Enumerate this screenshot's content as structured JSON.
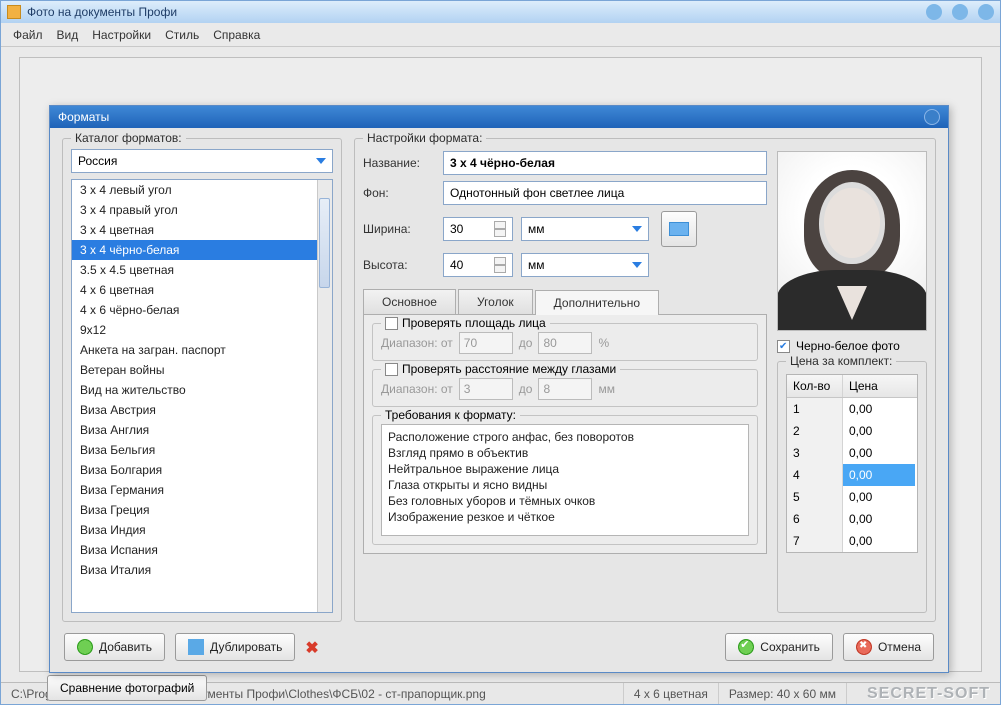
{
  "window": {
    "title": "Фото на документы Профи"
  },
  "menu": [
    "Файл",
    "Вид",
    "Настройки",
    "Стиль",
    "Справка"
  ],
  "bg_button": "Сравнение фотографий",
  "dialog": {
    "title": "Форматы",
    "catalog_legend": "Каталог форматов:",
    "country": "Россия",
    "items": [
      "3 x 4 левый угол",
      "3 x 4 правый угол",
      "3 x 4 цветная",
      "3 x 4 чёрно-белая",
      "3.5 x 4.5 цветная",
      "4 x 6 цветная",
      "4 x 6 чёрно-белая",
      "9x12",
      "Анкета на загран. паспорт",
      "Ветеран войны",
      "Вид на жительство",
      "Виза Австрия",
      "Виза Англия",
      "Виза Бельгия",
      "Виза Болгария",
      "Виза Германия",
      "Виза Греция",
      "Виза Индия",
      "Виза Испания",
      "Виза Италия"
    ],
    "selected_index": 3,
    "settings_legend": "Настройки формата:",
    "name_label": "Название:",
    "name_value": "3 x 4 чёрно-белая",
    "bg_label": "Фон:",
    "bg_value": "Однотонный фон светлее лица",
    "width_label": "Ширина:",
    "width_value": "30",
    "height_label": "Высота:",
    "height_value": "40",
    "unit": "мм",
    "tabs": [
      "Основное",
      "Уголок",
      "Дополнительно"
    ],
    "active_tab": 2,
    "check_face": "Проверять площадь лица",
    "check_eyes": "Проверять расстояние между глазами",
    "range_label": "Диапазон: от",
    "range_to": "до",
    "face_from": "70",
    "face_to": "80",
    "face_unit": "%",
    "eyes_from": "3",
    "eyes_to": "8",
    "eyes_unit": "мм",
    "reqs_legend": "Требования к формату:",
    "reqs": [
      "Расположение строго анфас, без поворотов",
      "Взгляд прямо в объектив",
      "Нейтральное выражение лица",
      "Глаза открыты и ясно видны",
      "Без головных уборов и тёмных очков",
      "Изображение резкое и чёткое"
    ],
    "bw_label": "Черно-белое фото",
    "price_legend": "Цена за комплект:",
    "price_headers": [
      "Кол-во",
      "Цена"
    ],
    "prices": [
      {
        "q": "1",
        "p": "0,00"
      },
      {
        "q": "2",
        "p": "0,00"
      },
      {
        "q": "3",
        "p": "0,00"
      },
      {
        "q": "4",
        "p": "0,00"
      },
      {
        "q": "5",
        "p": "0,00"
      },
      {
        "q": "6",
        "p": "0,00"
      },
      {
        "q": "7",
        "p": "0,00"
      }
    ],
    "price_selected": 3,
    "btn_add": "Добавить",
    "btn_dup": "Дублировать",
    "btn_save": "Сохранить",
    "btn_cancel": "Отмена"
  },
  "status": {
    "path": "C:\\Program Files (x86)\\Фото на документы Профи\\Clothes\\ФСБ\\02 - ст-прапорщик.png",
    "fmt": "4 x 6 цветная",
    "size": "Размер: 40 x 60 мм",
    "watermark": "SECRET-SOFT"
  }
}
